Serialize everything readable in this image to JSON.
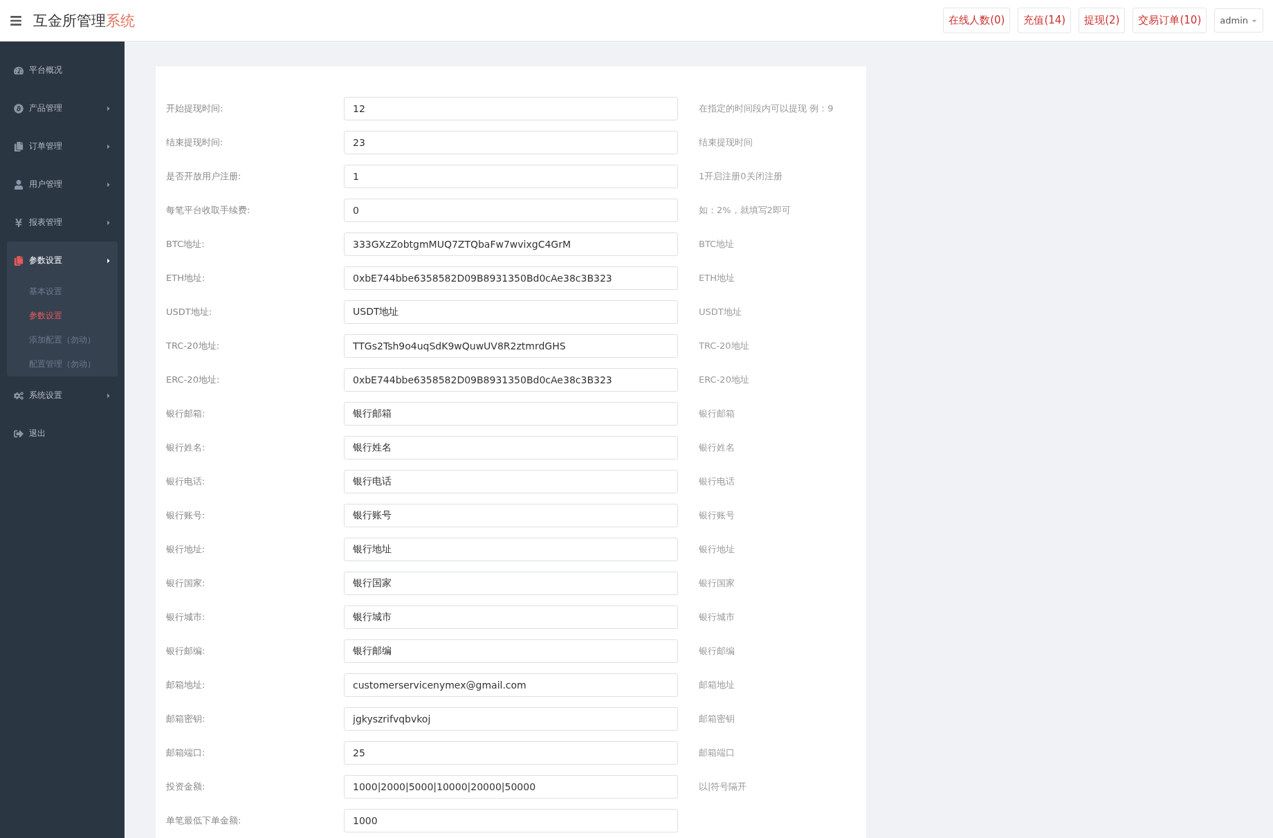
{
  "header": {
    "title": "互金所管理",
    "title_accent": "系统",
    "badges": [
      "在线人数(0)",
      "充值(14)",
      "提现(2)",
      "交易订单(10)"
    ],
    "user": "admin"
  },
  "sidebar": {
    "items": [
      {
        "label": "平台概况",
        "has_submenu": false,
        "expanded": false
      },
      {
        "label": "产品管理",
        "has_submenu": true,
        "expanded": false
      },
      {
        "label": "订单管理",
        "has_submenu": true,
        "expanded": false
      },
      {
        "label": "用户管理",
        "has_submenu": true,
        "expanded": false
      },
      {
        "label": "报表管理",
        "has_submenu": true,
        "expanded": false
      },
      {
        "label": "参数设置",
        "has_submenu": true,
        "expanded": true,
        "children": [
          {
            "label": "基本设置",
            "selected": false
          },
          {
            "label": "参数设置",
            "selected": true
          },
          {
            "label": "添加配置（勿动）",
            "selected": false
          },
          {
            "label": "配置管理（勿动）",
            "selected": false
          }
        ]
      },
      {
        "label": "系统设置",
        "has_submenu": true,
        "expanded": false
      },
      {
        "label": "退出",
        "has_submenu": false,
        "expanded": false
      }
    ]
  },
  "form": {
    "rows": [
      {
        "label": "开始提现时间:",
        "value": "12",
        "hint": "在指定的时间段内可以提现 例：9"
      },
      {
        "label": "结束提现时间:",
        "value": "23",
        "hint": "结束提现时间"
      },
      {
        "label": "是否开放用户注册:",
        "value": "1",
        "hint": "1开启注册0关闭注册"
      },
      {
        "label": "每笔平台收取手续费:",
        "value": "0",
        "hint": "如：2%，就填写2即可"
      },
      {
        "label": "BTC地址:",
        "value": "333GXzZobtgmMUQ7ZTQbaFw7wvixgC4GrM",
        "hint": "BTC地址"
      },
      {
        "label": "ETH地址:",
        "value": "0xbE744bbe6358582D09B8931350Bd0cAe38c3B323",
        "hint": "ETH地址"
      },
      {
        "label": "USDT地址:",
        "value": "USDT地址",
        "hint": "USDT地址"
      },
      {
        "label": "TRC-20地址:",
        "value": "TTGs2Tsh9o4uqSdK9wQuwUV8R2ztmrdGHS",
        "hint": "TRC-20地址"
      },
      {
        "label": "ERC-20地址:",
        "value": "0xbE744bbe6358582D09B8931350Bd0cAe38c3B323",
        "hint": "ERC-20地址"
      },
      {
        "label": "银行邮箱:",
        "value": "银行邮箱",
        "hint": "银行邮箱"
      },
      {
        "label": "银行姓名:",
        "value": "银行姓名",
        "hint": "银行姓名"
      },
      {
        "label": "银行电话:",
        "value": "银行电话",
        "hint": "银行电话"
      },
      {
        "label": "银行账号:",
        "value": "银行账号",
        "hint": "银行账号"
      },
      {
        "label": "银行地址:",
        "value": "银行地址",
        "hint": "银行地址"
      },
      {
        "label": "银行国家:",
        "value": "银行国家",
        "hint": "银行国家"
      },
      {
        "label": "银行城市:",
        "value": "银行城市",
        "hint": "银行城市"
      },
      {
        "label": "银行邮编:",
        "value": "银行邮编",
        "hint": "银行邮编"
      },
      {
        "label": "邮箱地址:",
        "value": "customerservicenymex@gmail.com",
        "hint": "邮箱地址"
      },
      {
        "label": "邮箱密钥:",
        "value": "jgkyszrifvqbvkoj",
        "hint": "邮箱密钥"
      },
      {
        "label": "邮箱端口:",
        "value": "25",
        "hint": "邮箱端口"
      },
      {
        "label": "投资金额:",
        "value": "1000|2000|5000|10000|20000|50000",
        "hint": "以|符号隔开"
      },
      {
        "label": "单笔最低下单金额:",
        "value": "1000"
      }
    ]
  }
}
